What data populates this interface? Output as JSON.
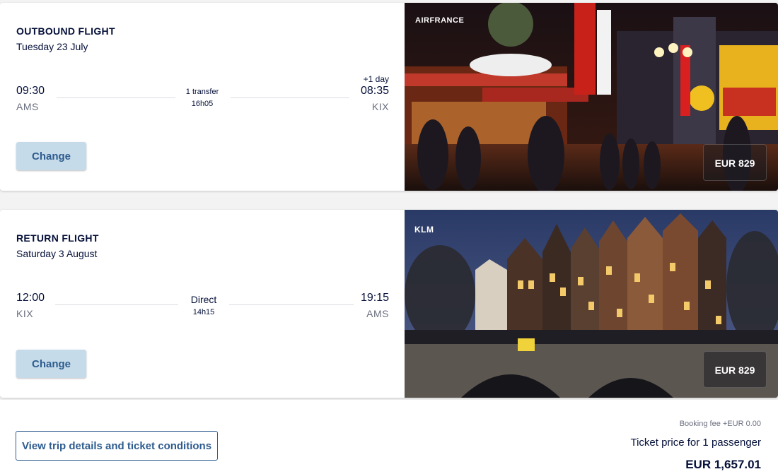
{
  "outbound": {
    "title": "OUTBOUND FLIGHT",
    "date": "Tuesday 23 July",
    "depart_time": "09:30",
    "depart_airport": "AMS",
    "stops": "1 transfer",
    "duration": "16h05",
    "day_offset": "+1 day",
    "arrive_time": "08:35",
    "arrive_airport": "KIX",
    "change_label": "Change",
    "airline": "AIRFRANCE",
    "price": "EUR 829"
  },
  "return": {
    "title": "RETURN FLIGHT",
    "date": "Saturday 3 August",
    "depart_time": "12:00",
    "depart_airport": "KIX",
    "stops": "Direct",
    "duration": "14h15",
    "arrive_time": "19:15",
    "arrive_airport": "AMS",
    "change_label": "Change",
    "airline": "KLM",
    "price": "EUR 829"
  },
  "summary": {
    "details_label": "View trip details and ticket conditions",
    "booking_fee": "Booking fee +EUR 0.00",
    "ticket_price_label": "Ticket price for 1 passenger",
    "total": "EUR 1,657.01"
  },
  "colors": {
    "navy": "#051039",
    "accent_blue": "#2e5c8e",
    "button_bg": "#c6dbea"
  }
}
